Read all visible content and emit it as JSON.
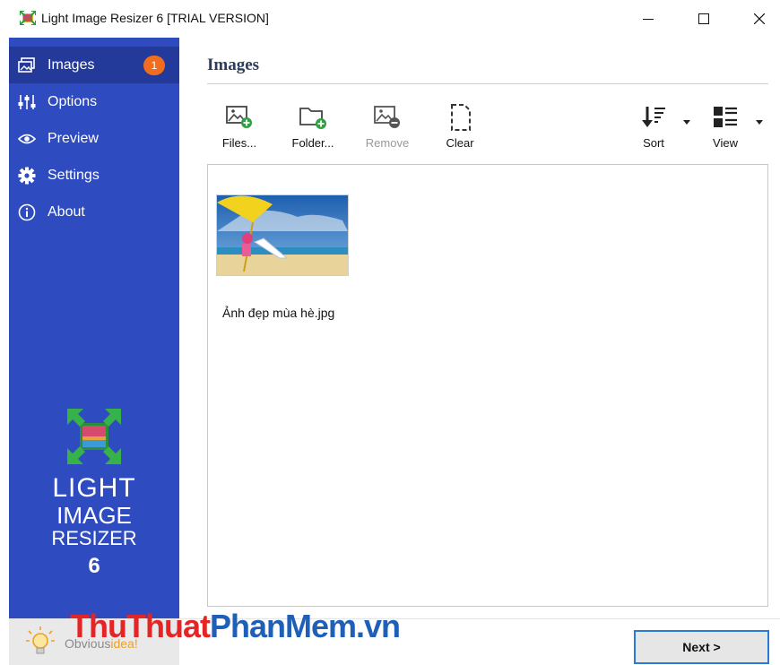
{
  "window": {
    "title": "Light Image Resizer 6  [TRIAL VERSION]",
    "min_icon": "minimize-icon",
    "max_icon": "maximize-icon",
    "close_icon": "close-icon"
  },
  "sidebar": {
    "items": [
      {
        "label": "Images",
        "icon": "images-icon",
        "active": true,
        "badge": "1"
      },
      {
        "label": "Options",
        "icon": "options-sliders-icon",
        "active": false
      },
      {
        "label": "Preview",
        "icon": "eye-icon",
        "active": false
      },
      {
        "label": "Settings",
        "icon": "gear-icon",
        "active": false
      },
      {
        "label": "About",
        "icon": "info-icon",
        "active": false
      }
    ],
    "brand": {
      "line1": "LIGHT",
      "line2": "IMAGE",
      "line3": "RESIZER",
      "line4": "6"
    },
    "footer": {
      "text_a": "Obvious",
      "text_b": "idea!"
    }
  },
  "main": {
    "title": "Images",
    "toolbar": {
      "files_label": "Files...",
      "folder_label": "Folder...",
      "remove_label": "Remove",
      "clear_label": "Clear",
      "sort_label": "Sort",
      "view_label": "View"
    },
    "files": [
      {
        "name": "Ảnh đẹp mùa hè.jpg"
      }
    ],
    "next_label": "Next >"
  },
  "watermark": {
    "part_a": "ThuThuat",
    "part_b": "PhanMem.vn"
  },
  "colors": {
    "sidebar": "#2f4bc0",
    "sidebar_active": "#233a9a",
    "badge": "#f06c1e",
    "accent": "#2a7ad6"
  }
}
